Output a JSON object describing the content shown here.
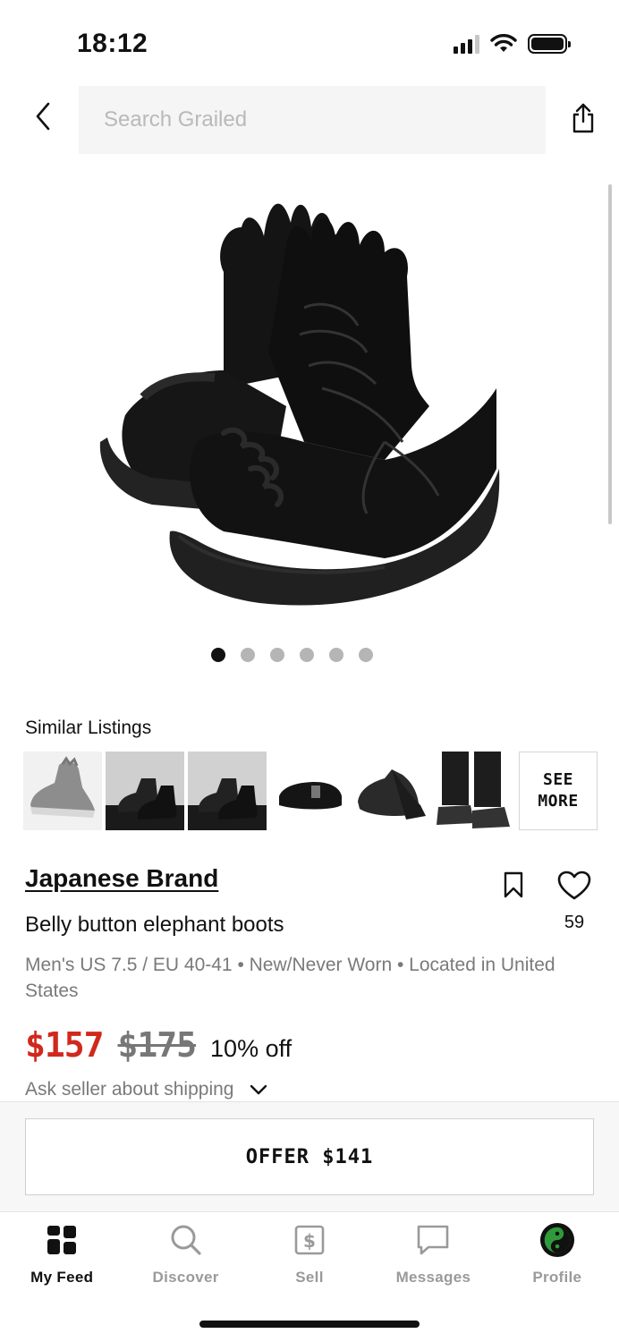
{
  "status_bar": {
    "time": "18:12"
  },
  "header": {
    "search_placeholder": "Search Grailed"
  },
  "gallery": {
    "image_count": 6,
    "active_index": 0,
    "alt": "Black boots with frilled edges"
  },
  "similar": {
    "title": "Similar Listings",
    "see_more_line1": "SEE",
    "see_more_line2": "MORE",
    "thumbnails": [
      "grey ruffle sneaker",
      "black leather boots",
      "black leather boots",
      "black platform buckle shoe",
      "black lace-up shoe",
      "black trousers with boots"
    ]
  },
  "product": {
    "brand": "Japanese Brand",
    "title": "Belly button elephant boots",
    "meta": "Men's US 7.5 / EU 40-41  •  New/Never Worn  •  Located in United States",
    "price": "$157",
    "original_price": "$175",
    "discount": "10% off",
    "shipping": "Ask seller about shipping",
    "likes": "59"
  },
  "offer": {
    "label": "OFFER $141"
  },
  "tabs": [
    {
      "label": "My Feed",
      "icon": "feed-grid-icon",
      "active": true
    },
    {
      "label": "Discover",
      "icon": "search-icon",
      "active": false
    },
    {
      "label": "Sell",
      "icon": "dollar-tag-icon",
      "active": false
    },
    {
      "label": "Messages",
      "icon": "chat-bubble-icon",
      "active": false
    },
    {
      "label": "Profile",
      "icon": "yin-yang-avatar-icon",
      "active": false
    }
  ],
  "colors": {
    "price_red": "#d0291c",
    "profile_green": "#2f9a3a"
  }
}
